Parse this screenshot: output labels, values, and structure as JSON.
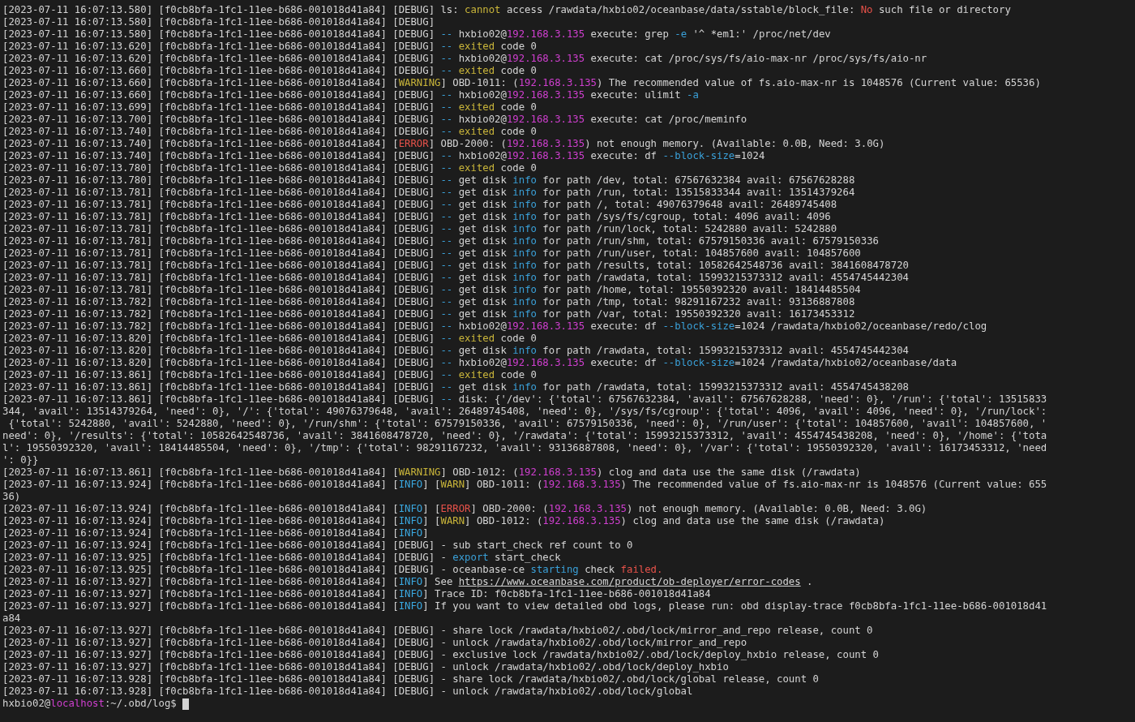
{
  "terminal": {
    "lines": [
      {
        "time": "[2023-07-11 16:07:13.580]",
        "trace": "[f0cb8bfa-1fc1-11ee-b686-001018d41a84]",
        "msg": [
          "[DEBUG] ls: ",
          {
            "text": "cannot",
            "kind": "warn"
          },
          " access /rawdata/hxbio02/oceanbase/data/sstable/block_file: ",
          {
            "text": "No",
            "kind": "err"
          },
          " such file or directory"
        ]
      },
      {
        "time": "[2023-07-11 16:07:13.580]",
        "trace": "[f0cb8bfa-1fc1-11ee-b686-001018d41a84]",
        "msg": [
          "[DEBUG]"
        ]
      },
      {
        "time": "[2023-07-11 16:07:13.580]",
        "trace": "[f0cb8bfa-1fc1-11ee-b686-001018d41a84]",
        "msg": [
          "[DEBUG] ",
          {
            "text": "--",
            "kind": "opt"
          },
          " hxbio02@",
          {
            "text": "192.168.3.135",
            "kind": "ip"
          },
          " execute: grep ",
          {
            "text": "-e",
            "kind": "opt"
          },
          " '^ *em1:' /proc/net/dev"
        ]
      },
      {
        "time": "[2023-07-11 16:07:13.620]",
        "trace": "[f0cb8bfa-1fc1-11ee-b686-001018d41a84]",
        "msg": [
          "[DEBUG] ",
          {
            "text": "-- ",
            "kind": "opt"
          },
          {
            "text": "exited",
            "kind": "warn"
          },
          " code 0"
        ]
      },
      {
        "time": "[2023-07-11 16:07:13.620]",
        "trace": "[f0cb8bfa-1fc1-11ee-b686-001018d41a84]",
        "msg": [
          "[DEBUG] ",
          {
            "text": "--",
            "kind": "opt"
          },
          " hxbio02@",
          {
            "text": "192.168.3.135",
            "kind": "ip"
          },
          " execute: cat /proc/sys/fs/aio-max-nr /proc/sys/fs/aio-nr"
        ]
      },
      {
        "time": "[2023-07-11 16:07:13.660]",
        "trace": "[f0cb8bfa-1fc1-11ee-b686-001018d41a84]",
        "msg": [
          "[DEBUG] ",
          {
            "text": "-- ",
            "kind": "opt"
          },
          {
            "text": "exited",
            "kind": "warn"
          },
          " code 0"
        ]
      },
      {
        "time": "[2023-07-11 16:07:13.660]",
        "trace": "[f0cb8bfa-1fc1-11ee-b686-001018d41a84]",
        "msg": [
          "[",
          {
            "text": "WARNING",
            "kind": "warn"
          },
          "] OBD-1011: (",
          {
            "text": "192.168.3.135",
            "kind": "ip"
          },
          ") The recommended value of fs.aio-max-nr is 1048576 (Current value: 65536)"
        ]
      },
      {
        "time": "[2023-07-11 16:07:13.660]",
        "trace": "[f0cb8bfa-1fc1-11ee-b686-001018d41a84]",
        "msg": [
          "[DEBUG] ",
          {
            "text": "--",
            "kind": "opt"
          },
          " hxbio02@",
          {
            "text": "192.168.3.135",
            "kind": "ip"
          },
          " execute: ulimit ",
          {
            "text": "-a",
            "kind": "opt"
          }
        ]
      },
      {
        "time": "[2023-07-11 16:07:13.699]",
        "trace": "[f0cb8bfa-1fc1-11ee-b686-001018d41a84]",
        "msg": [
          "[DEBUG] ",
          {
            "text": "-- ",
            "kind": "opt"
          },
          {
            "text": "exited",
            "kind": "warn"
          },
          " code 0"
        ]
      },
      {
        "time": "[2023-07-11 16:07:13.700]",
        "trace": "[f0cb8bfa-1fc1-11ee-b686-001018d41a84]",
        "msg": [
          "[DEBUG] ",
          {
            "text": "--",
            "kind": "opt"
          },
          " hxbio02@",
          {
            "text": "192.168.3.135",
            "kind": "ip"
          },
          " execute: cat /proc/meminfo"
        ]
      },
      {
        "time": "[2023-07-11 16:07:13.740]",
        "trace": "[f0cb8bfa-1fc1-11ee-b686-001018d41a84]",
        "msg": [
          "[DEBUG] ",
          {
            "text": "-- ",
            "kind": "opt"
          },
          {
            "text": "exited",
            "kind": "warn"
          },
          " code 0"
        ]
      },
      {
        "time": "[2023-07-11 16:07:13.740]",
        "trace": "[f0cb8bfa-1fc1-11ee-b686-001018d41a84]",
        "msg": [
          "[",
          {
            "text": "ERROR",
            "kind": "err"
          },
          "] OBD-2000: (",
          {
            "text": "192.168.3.135",
            "kind": "ip"
          },
          ") not enough memory. (Available: 0.0B, Need: 3.0G)"
        ]
      },
      {
        "time": "[2023-07-11 16:07:13.740]",
        "trace": "[f0cb8bfa-1fc1-11ee-b686-001018d41a84]",
        "msg": [
          "[DEBUG] ",
          {
            "text": "--",
            "kind": "opt"
          },
          " hxbio02@",
          {
            "text": "192.168.3.135",
            "kind": "ip"
          },
          " execute: df ",
          {
            "text": "--block-size",
            "kind": "opt"
          },
          "=1024"
        ]
      },
      {
        "time": "[2023-07-11 16:07:13.780]",
        "trace": "[f0cb8bfa-1fc1-11ee-b686-001018d41a84]",
        "msg": [
          "[DEBUG] ",
          {
            "text": "-- ",
            "kind": "opt"
          },
          {
            "text": "exited",
            "kind": "warn"
          },
          " code 0"
        ]
      },
      {
        "time": "[2023-07-11 16:07:13.780]",
        "trace": "[f0cb8bfa-1fc1-11ee-b686-001018d41a84]",
        "msg": [
          "[DEBUG] ",
          {
            "text": "--",
            "kind": "opt"
          },
          " get disk ",
          {
            "text": "info",
            "kind": "opt"
          },
          " for path /dev, total: 67567632384 avail: 67567628288"
        ]
      },
      {
        "time": "[2023-07-11 16:07:13.781]",
        "trace": "[f0cb8bfa-1fc1-11ee-b686-001018d41a84]",
        "msg": [
          "[DEBUG] ",
          {
            "text": "--",
            "kind": "opt"
          },
          " get disk ",
          {
            "text": "info",
            "kind": "opt"
          },
          " for path /run, total: 13515833344 avail: 13514379264"
        ]
      },
      {
        "time": "[2023-07-11 16:07:13.781]",
        "trace": "[f0cb8bfa-1fc1-11ee-b686-001018d41a84]",
        "msg": [
          "[DEBUG] ",
          {
            "text": "--",
            "kind": "opt"
          },
          " get disk ",
          {
            "text": "info",
            "kind": "opt"
          },
          " for path /, total: 49076379648 avail: 26489745408"
        ]
      },
      {
        "time": "[2023-07-11 16:07:13.781]",
        "trace": "[f0cb8bfa-1fc1-11ee-b686-001018d41a84]",
        "msg": [
          "[DEBUG] ",
          {
            "text": "--",
            "kind": "opt"
          },
          " get disk ",
          {
            "text": "info",
            "kind": "opt"
          },
          " for path /sys/fs/cgroup, total: 4096 avail: 4096"
        ]
      },
      {
        "time": "[2023-07-11 16:07:13.781]",
        "trace": "[f0cb8bfa-1fc1-11ee-b686-001018d41a84]",
        "msg": [
          "[DEBUG] ",
          {
            "text": "--",
            "kind": "opt"
          },
          " get disk ",
          {
            "text": "info",
            "kind": "opt"
          },
          " for path /run/lock, total: 5242880 avail: 5242880"
        ]
      },
      {
        "time": "[2023-07-11 16:07:13.781]",
        "trace": "[f0cb8bfa-1fc1-11ee-b686-001018d41a84]",
        "msg": [
          "[DEBUG] ",
          {
            "text": "--",
            "kind": "opt"
          },
          " get disk ",
          {
            "text": "info",
            "kind": "opt"
          },
          " for path /run/shm, total: 67579150336 avail: 67579150336"
        ]
      },
      {
        "time": "[2023-07-11 16:07:13.781]",
        "trace": "[f0cb8bfa-1fc1-11ee-b686-001018d41a84]",
        "msg": [
          "[DEBUG] ",
          {
            "text": "--",
            "kind": "opt"
          },
          " get disk ",
          {
            "text": "info",
            "kind": "opt"
          },
          " for path /run/user, total: 104857600 avail: 104857600"
        ]
      },
      {
        "time": "[2023-07-11 16:07:13.781]",
        "trace": "[f0cb8bfa-1fc1-11ee-b686-001018d41a84]",
        "msg": [
          "[DEBUG] ",
          {
            "text": "--",
            "kind": "opt"
          },
          " get disk ",
          {
            "text": "info",
            "kind": "opt"
          },
          " for path /results, total: 10582642548736 avail: 3841608478720"
        ]
      },
      {
        "time": "[2023-07-11 16:07:13.781]",
        "trace": "[f0cb8bfa-1fc1-11ee-b686-001018d41a84]",
        "msg": [
          "[DEBUG] ",
          {
            "text": "--",
            "kind": "opt"
          },
          " get disk ",
          {
            "text": "info",
            "kind": "opt"
          },
          " for path /rawdata, total: 15993215373312 avail: 4554745442304"
        ]
      },
      {
        "time": "[2023-07-11 16:07:13.781]",
        "trace": "[f0cb8bfa-1fc1-11ee-b686-001018d41a84]",
        "msg": [
          "[DEBUG] ",
          {
            "text": "--",
            "kind": "opt"
          },
          " get disk ",
          {
            "text": "info",
            "kind": "opt"
          },
          " for path /home, total: 19550392320 avail: 18414485504"
        ]
      },
      {
        "time": "[2023-07-11 16:07:13.782]",
        "trace": "[f0cb8bfa-1fc1-11ee-b686-001018d41a84]",
        "msg": [
          "[DEBUG] ",
          {
            "text": "--",
            "kind": "opt"
          },
          " get disk ",
          {
            "text": "info",
            "kind": "opt"
          },
          " for path /tmp, total: 98291167232 avail: 93136887808"
        ]
      },
      {
        "time": "[2023-07-11 16:07:13.782]",
        "trace": "[f0cb8bfa-1fc1-11ee-b686-001018d41a84]",
        "msg": [
          "[DEBUG] ",
          {
            "text": "--",
            "kind": "opt"
          },
          " get disk ",
          {
            "text": "info",
            "kind": "opt"
          },
          " for path /var, total: 19550392320 avail: 16173453312"
        ]
      },
      {
        "time": "[2023-07-11 16:07:13.782]",
        "trace": "[f0cb8bfa-1fc1-11ee-b686-001018d41a84]",
        "msg": [
          "[DEBUG] ",
          {
            "text": "--",
            "kind": "opt"
          },
          " hxbio02@",
          {
            "text": "192.168.3.135",
            "kind": "ip"
          },
          " execute: df ",
          {
            "text": "--block-size",
            "kind": "opt"
          },
          "=1024 /rawdata/hxbio02/oceanbase/redo/clog"
        ]
      },
      {
        "time": "[2023-07-11 16:07:13.820]",
        "trace": "[f0cb8bfa-1fc1-11ee-b686-001018d41a84]",
        "msg": [
          "[DEBUG] ",
          {
            "text": "-- ",
            "kind": "opt"
          },
          {
            "text": "exited",
            "kind": "warn"
          },
          " code 0"
        ]
      },
      {
        "time": "[2023-07-11 16:07:13.820]",
        "trace": "[f0cb8bfa-1fc1-11ee-b686-001018d41a84]",
        "msg": [
          "[DEBUG] ",
          {
            "text": "--",
            "kind": "opt"
          },
          " get disk ",
          {
            "text": "info",
            "kind": "opt"
          },
          " for path /rawdata, total: 15993215373312 avail: 4554745442304"
        ]
      },
      {
        "time": "[2023-07-11 16:07:13.820]",
        "trace": "[f0cb8bfa-1fc1-11ee-b686-001018d41a84]",
        "msg": [
          "[DEBUG] ",
          {
            "text": "--",
            "kind": "opt"
          },
          " hxbio02@",
          {
            "text": "192.168.3.135",
            "kind": "ip"
          },
          " execute: df ",
          {
            "text": "--block-size",
            "kind": "opt"
          },
          "=1024 /rawdata/hxbio02/oceanbase/data"
        ]
      },
      {
        "time": "[2023-07-11 16:07:13.861]",
        "trace": "[f0cb8bfa-1fc1-11ee-b686-001018d41a84]",
        "msg": [
          "[DEBUG] ",
          {
            "text": "-- ",
            "kind": "opt"
          },
          {
            "text": "exited",
            "kind": "warn"
          },
          " code 0"
        ]
      },
      {
        "time": "[2023-07-11 16:07:13.861]",
        "trace": "[f0cb8bfa-1fc1-11ee-b686-001018d41a84]",
        "msg": [
          "[DEBUG] ",
          {
            "text": "--",
            "kind": "opt"
          },
          " get disk ",
          {
            "text": "info",
            "kind": "opt"
          },
          " for path /rawdata, total: 15993215373312 avail: 4554745438208"
        ]
      },
      {
        "time": "[2023-07-11 16:07:13.861]",
        "trace": "[f0cb8bfa-1fc1-11ee-b686-001018d41a84]",
        "msg": [
          "[DEBUG] ",
          {
            "text": "--",
            "kind": "opt"
          },
          " disk: {'/dev': {'total': 67567632384, 'avail': 67567628288, 'need': 0}, '/run': {'total': 13515833"
        ],
        "cont": [
          "344, 'avail': 13514379264, 'need': 0}, '/': {'total': 49076379648, 'avail': 26489745408, 'need': 0}, '/sys/fs/cgroup': {'total': 4096, 'avail': 4096, 'need': 0}, '/run/lock':",
          " {'total': 5242880, 'avail': 5242880, 'need': 0}, '/run/shm': {'total': 67579150336, 'avail': 67579150336, 'need': 0}, '/run/user': {'total': 104857600, 'avail': 104857600, '",
          "need': 0}, '/results': {'total': 10582642548736, 'avail': 3841608478720, 'need': 0}, '/rawdata': {'total': 15993215373312, 'avail': 4554745438208, 'need': 0}, '/home': {'tota",
          "l': 19550392320, 'avail': 18414485504, 'need': 0}, '/tmp': {'total': 98291167232, 'avail': 93136887808, 'need': 0}, '/var': {'total': 19550392320, 'avail': 16173453312, 'need",
          "': 0}}"
        ]
      },
      {
        "time": "[2023-07-11 16:07:13.861]",
        "trace": "[f0cb8bfa-1fc1-11ee-b686-001018d41a84]",
        "msg": [
          "[",
          {
            "text": "WARNING",
            "kind": "warn"
          },
          "] OBD-1012: (",
          {
            "text": "192.168.3.135",
            "kind": "ip"
          },
          ") clog and data use the same disk (/rawdata)"
        ]
      },
      {
        "time": "[2023-07-11 16:07:13.924]",
        "trace": "[f0cb8bfa-1fc1-11ee-b686-001018d41a84]",
        "msg": [
          "[",
          {
            "text": "INFO",
            "kind": "info"
          },
          "] [",
          {
            "text": "WARN",
            "kind": "warn"
          },
          "] OBD-1011: (",
          {
            "text": "192.168.3.135",
            "kind": "ip"
          },
          ") The recommended value of fs.aio-max-nr is 1048576 (Current value: 655"
        ],
        "cont": [
          "36)"
        ]
      },
      {
        "time": "[2023-07-11 16:07:13.924]",
        "trace": "[f0cb8bfa-1fc1-11ee-b686-001018d41a84]",
        "msg": [
          "[",
          {
            "text": "INFO",
            "kind": "info"
          },
          "] [",
          {
            "text": "ERROR",
            "kind": "err"
          },
          "] OBD-2000: (",
          {
            "text": "192.168.3.135",
            "kind": "ip"
          },
          ") not enough memory. (Available: 0.0B, Need: 3.0G)"
        ]
      },
      {
        "time": "[2023-07-11 16:07:13.924]",
        "trace": "[f0cb8bfa-1fc1-11ee-b686-001018d41a84]",
        "msg": [
          "[",
          {
            "text": "INFO",
            "kind": "info"
          },
          "] [",
          {
            "text": "WARN",
            "kind": "warn"
          },
          "] OBD-1012: (",
          {
            "text": "192.168.3.135",
            "kind": "ip"
          },
          ") clog and data use the same disk (/rawdata)"
        ]
      },
      {
        "time": "[2023-07-11 16:07:13.924]",
        "trace": "[f0cb8bfa-1fc1-11ee-b686-001018d41a84]",
        "msg": [
          "[",
          {
            "text": "INFO",
            "kind": "info"
          },
          "]"
        ]
      },
      {
        "time": "[2023-07-11 16:07:13.924]",
        "trace": "[f0cb8bfa-1fc1-11ee-b686-001018d41a84]",
        "msg": [
          "[DEBUG] - sub start_check ref count to 0"
        ]
      },
      {
        "time": "[2023-07-11 16:07:13.925]",
        "trace": "[f0cb8bfa-1fc1-11ee-b686-001018d41a84]",
        "msg": [
          "[DEBUG] - ",
          {
            "text": "export",
            "kind": "opt"
          },
          " start_check"
        ]
      },
      {
        "time": "[2023-07-11 16:07:13.925]",
        "trace": "[f0cb8bfa-1fc1-11ee-b686-001018d41a84]",
        "msg": [
          "[DEBUG] - oceanbase-ce ",
          {
            "text": "starting",
            "kind": "opt"
          },
          " check ",
          {
            "text": "failed.",
            "kind": "err"
          }
        ]
      },
      {
        "time": "[2023-07-11 16:07:13.927]",
        "trace": "[f0cb8bfa-1fc1-11ee-b686-001018d41a84]",
        "msg": [
          "[",
          {
            "text": "INFO",
            "kind": "info"
          },
          "] See ",
          {
            "text": "https://www.oceanbase.com/product/ob-deployer/error-codes",
            "kind": "link"
          },
          " ."
        ]
      },
      {
        "time": "[2023-07-11 16:07:13.927]",
        "trace": "[f0cb8bfa-1fc1-11ee-b686-001018d41a84]",
        "msg": [
          "[",
          {
            "text": "INFO",
            "kind": "info"
          },
          "] Trace ID: f0cb8bfa-1fc1-11ee-b686-001018d41a84"
        ]
      },
      {
        "time": "[2023-07-11 16:07:13.927]",
        "trace": "[f0cb8bfa-1fc1-11ee-b686-001018d41a84]",
        "msg": [
          "[",
          {
            "text": "INFO",
            "kind": "info"
          },
          "] If you want to view detailed obd logs, please run: obd display-trace f0cb8bfa-1fc1-11ee-b686-001018d41"
        ],
        "cont": [
          "a84"
        ]
      },
      {
        "time": "[2023-07-11 16:07:13.927]",
        "trace": "[f0cb8bfa-1fc1-11ee-b686-001018d41a84]",
        "msg": [
          "[DEBUG] - share lock /rawdata/hxbio02/.obd/lock/mirror_and_repo release, count 0"
        ]
      },
      {
        "time": "[2023-07-11 16:07:13.927]",
        "trace": "[f0cb8bfa-1fc1-11ee-b686-001018d41a84]",
        "msg": [
          "[DEBUG] - unlock /rawdata/hxbio02/.obd/lock/mirror_and_repo"
        ]
      },
      {
        "time": "[2023-07-11 16:07:13.927]",
        "trace": "[f0cb8bfa-1fc1-11ee-b686-001018d41a84]",
        "msg": [
          "[DEBUG] - exclusive lock /rawdata/hxbio02/.obd/lock/deploy_hxbio release, count 0"
        ]
      },
      {
        "time": "[2023-07-11 16:07:13.927]",
        "trace": "[f0cb8bfa-1fc1-11ee-b686-001018d41a84]",
        "msg": [
          "[DEBUG] - unlock /rawdata/hxbio02/.obd/lock/deploy_hxbio"
        ]
      },
      {
        "time": "[2023-07-11 16:07:13.928]",
        "trace": "[f0cb8bfa-1fc1-11ee-b686-001018d41a84]",
        "msg": [
          "[DEBUG] - share lock /rawdata/hxbio02/.obd/lock/global release, count 0"
        ]
      },
      {
        "time": "[2023-07-11 16:07:13.928]",
        "trace": "[f0cb8bfa-1fc1-11ee-b686-001018d41a84]",
        "msg": [
          "[DEBUG] - unlock /rawdata/hxbio02/.obd/lock/global"
        ]
      }
    ],
    "prompt": {
      "user": "hxbio02@",
      "host": "localhost",
      "path": ":~/.obd/log$"
    }
  }
}
